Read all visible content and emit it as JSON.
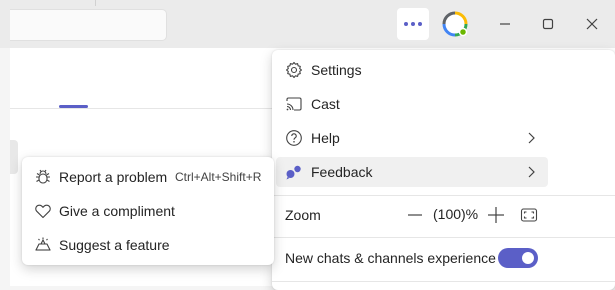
{
  "colors": {
    "accent": "#5b5fc7",
    "menu_bg": "#ffffff",
    "titlebar_bg": "#ebebeb"
  },
  "titlebar": {
    "more_icon": "more-horizontal-icon",
    "avatar_icon": "profile-avatar",
    "minimize_icon": "minimize-icon",
    "maximize_icon": "maximize-icon",
    "close_icon": "close-icon"
  },
  "menu": {
    "items": [
      {
        "label": "Settings",
        "icon": "gear-icon"
      },
      {
        "label": "Cast",
        "icon": "cast-icon"
      },
      {
        "label": "Help",
        "icon": "help-icon",
        "has_submenu": true
      },
      {
        "label": "Feedback",
        "icon": "feedback-icon",
        "has_submenu": true,
        "active": true
      }
    ],
    "zoom": {
      "label": "Zoom",
      "value": "(100)%"
    },
    "toggle": {
      "label": "New chats & channels experience",
      "on": true
    }
  },
  "submenu": {
    "items": [
      {
        "label": "Report a problem",
        "shortcut": "Ctrl+Alt+Shift+R",
        "icon": "bug-icon"
      },
      {
        "label": "Give a compliment",
        "icon": "heart-icon"
      },
      {
        "label": "Suggest a feature",
        "icon": "lightbulb-icon"
      }
    ]
  }
}
